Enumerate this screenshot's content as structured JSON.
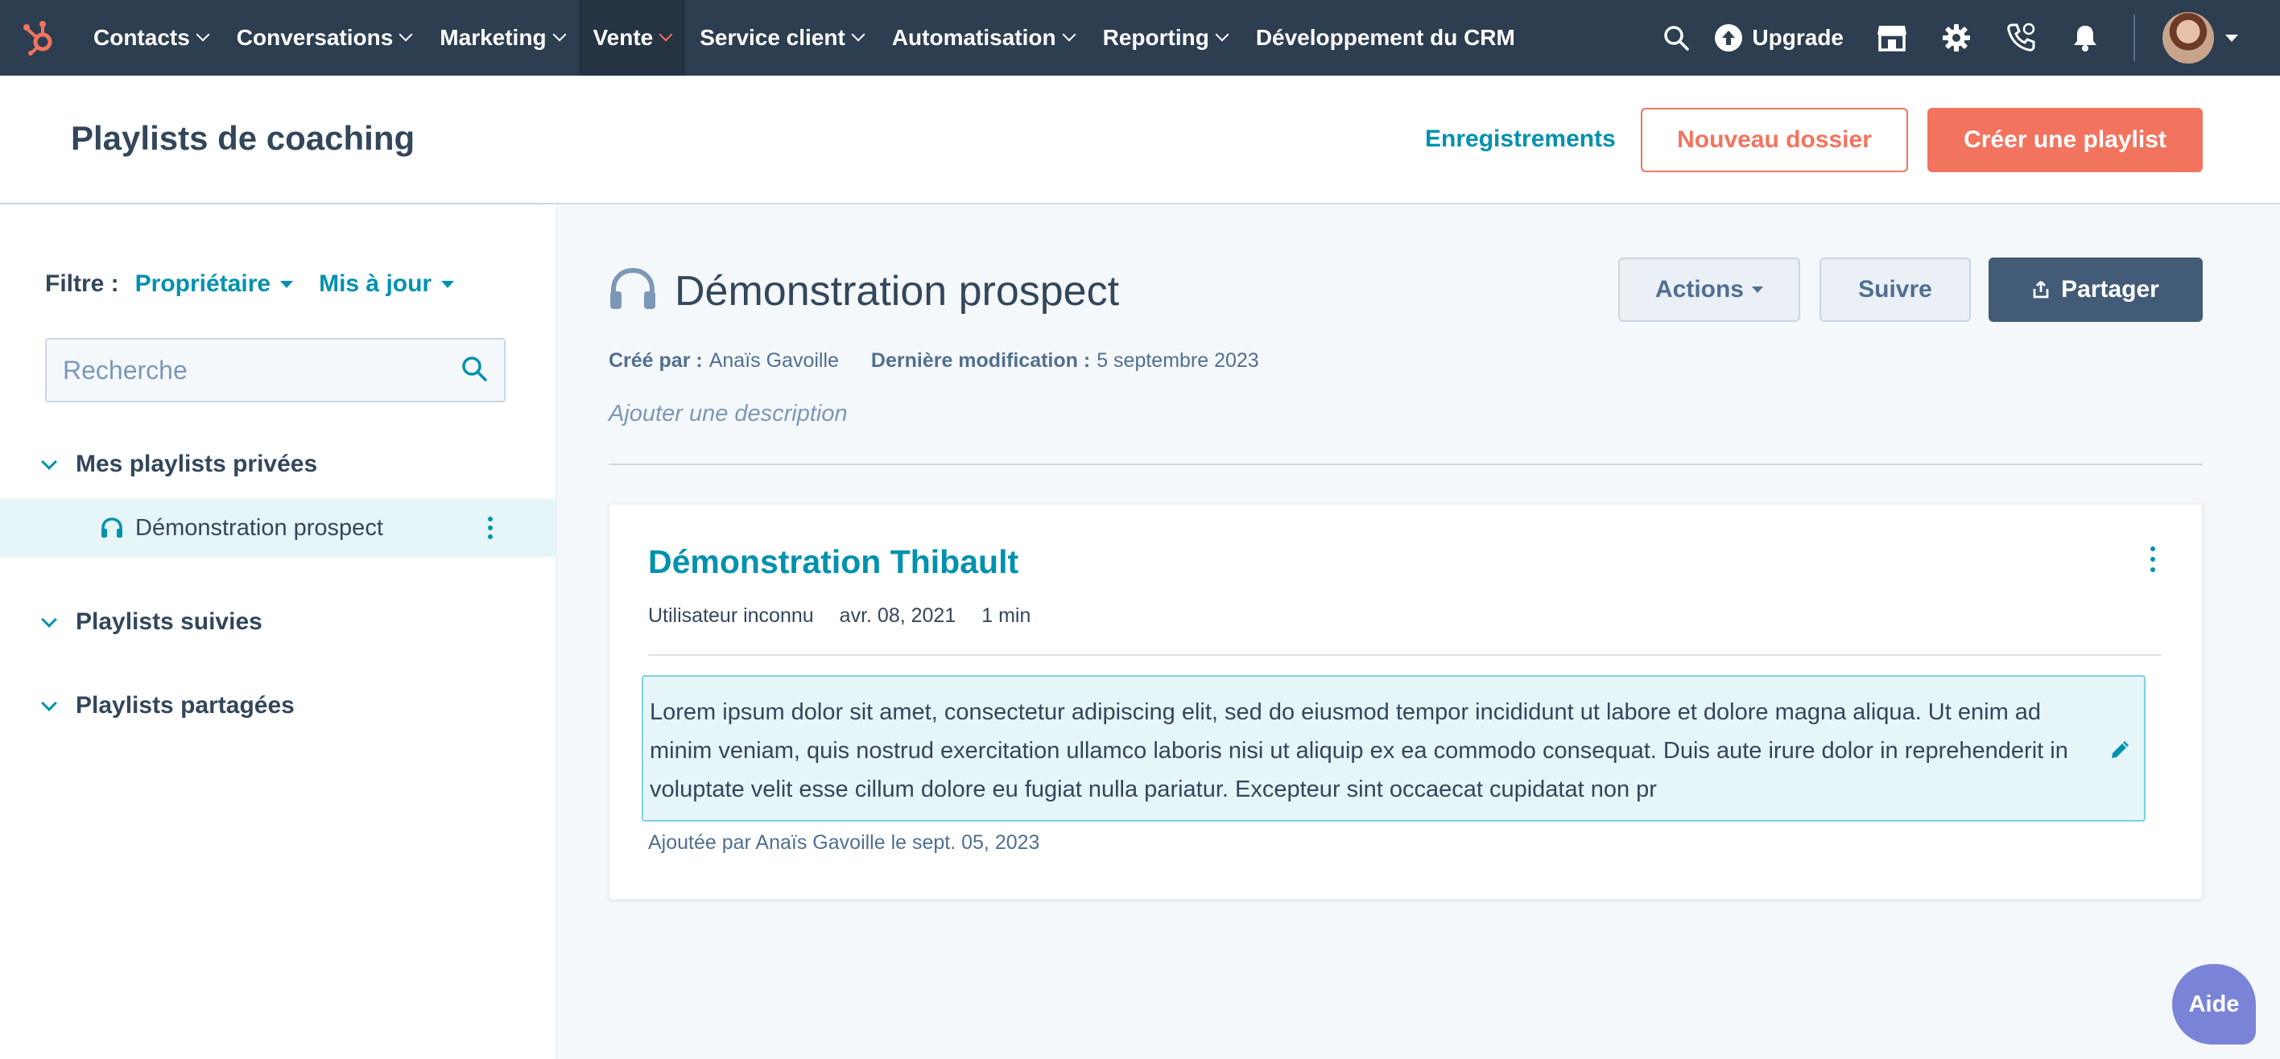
{
  "nav": {
    "items": [
      {
        "label": "Contacts",
        "dropdown": true
      },
      {
        "label": "Conversations",
        "dropdown": true
      },
      {
        "label": "Marketing",
        "dropdown": true
      },
      {
        "label": "Vente",
        "dropdown": true,
        "active": true
      },
      {
        "label": "Service client",
        "dropdown": true
      },
      {
        "label": "Automatisation",
        "dropdown": true
      },
      {
        "label": "Reporting",
        "dropdown": true
      },
      {
        "label": "Développement du CRM",
        "dropdown": false
      }
    ],
    "upgrade_label": "Upgrade",
    "icons": [
      "search-icon",
      "upgrade-icon",
      "marketplace-icon",
      "settings-icon",
      "calling-icon",
      "notifications-icon"
    ]
  },
  "header": {
    "title": "Playlists de coaching",
    "recordings_link": "Enregistrements",
    "new_folder_button": "Nouveau dossier",
    "create_playlist_button": "Créer une playlist"
  },
  "sidebar": {
    "filter_label": "Filtre :",
    "filter_owner": "Propriétaire",
    "filter_updated": "Mis à jour",
    "search_placeholder": "Recherche",
    "sections": {
      "private": "Mes playlists privées",
      "followed": "Playlists suivies",
      "shared": "Playlists partagées"
    },
    "private_items": [
      "Démonstration prospect"
    ]
  },
  "playlist": {
    "title": "Démonstration prospect",
    "actions_button": "Actions",
    "follow_button": "Suivre",
    "share_button": "Partager",
    "created_by_label": "Créé par :",
    "created_by": "Anaïs Gavoille",
    "modified_label": "Dernière modification :",
    "modified": "5 septembre 2023",
    "add_description": "Ajouter une description"
  },
  "card": {
    "title": "Démonstration Thibault",
    "user": "Utilisateur inconnu",
    "date": "avr. 08, 2021",
    "duration": "1 min",
    "note": "Lorem ipsum dolor sit amet, consectetur adipiscing elit, sed do eiusmod tempor incididunt ut labore et dolore magna aliqua. Ut enim ad minim veniam, quis nostrud exercitation ullamco laboris nisi ut aliquip ex ea commodo consequat. Duis aute irure dolor in reprehenderit in voluptate velit esse cillum dolore eu fugiat nulla pariatur. Excepteur sint occaecat cupidatat non pr",
    "added_by": "Ajoutée par Anaïs Gavoille le sept. 05, 2023"
  },
  "help_button": "Aide",
  "colors": {
    "nav_bg": "#2d3e50",
    "accent_orange": "#f2745f",
    "link_teal": "#0091ae",
    "dark_button": "#425b76",
    "help_purple": "#7a84d7"
  }
}
